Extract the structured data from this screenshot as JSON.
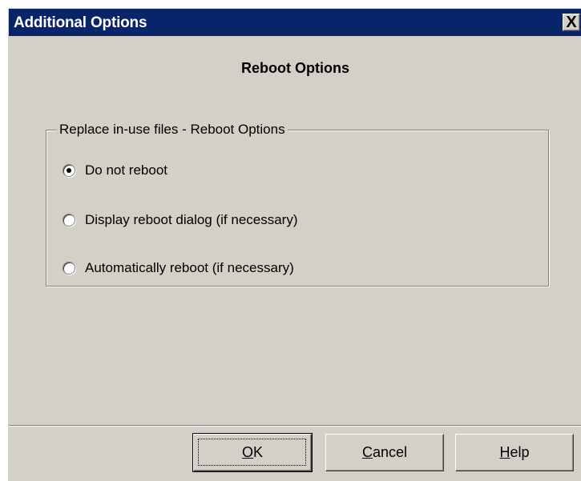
{
  "window": {
    "title": "Additional Options",
    "close_icon": "close-icon",
    "close_glyph": "X"
  },
  "heading": "Reboot Options",
  "group": {
    "legend": "Replace in-use files - Reboot Options",
    "options": [
      {
        "label": "Do not reboot",
        "checked": true
      },
      {
        "label": "Display reboot dialog (if necessary)",
        "checked": false
      },
      {
        "label": "Automatically reboot (if necessary)",
        "checked": false
      }
    ]
  },
  "buttons": {
    "ok": {
      "mnemonic": "O",
      "rest": "K"
    },
    "cancel": {
      "mnemonic": "C",
      "rest": "ancel"
    },
    "help": {
      "mnemonic": "H",
      "rest": "elp"
    }
  },
  "colors": {
    "titlebar": "#0a246a",
    "face": "#d4d0c8"
  }
}
